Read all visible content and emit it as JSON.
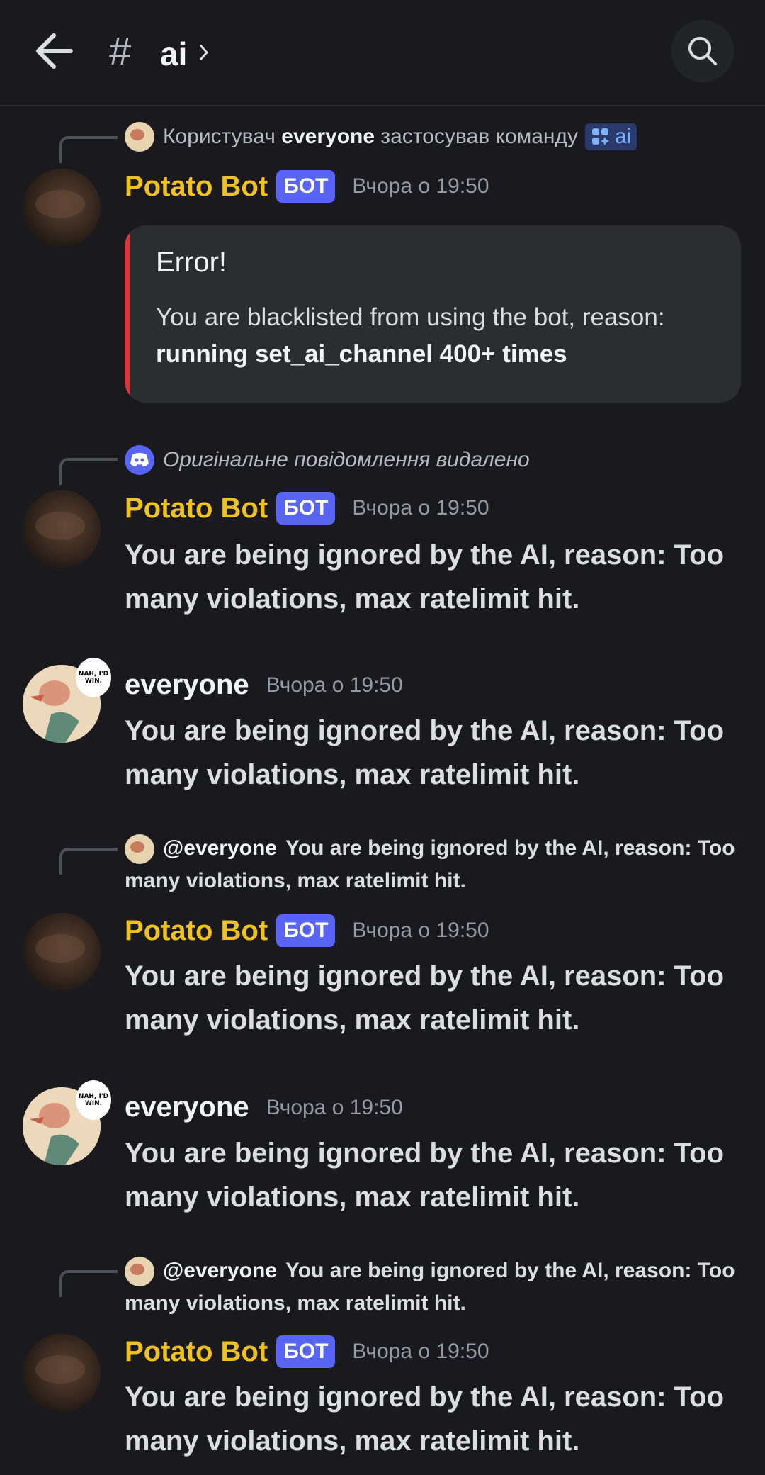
{
  "header": {
    "hash": "#",
    "channel_name": "ai"
  },
  "messages": [
    {
      "type": "command",
      "reply": {
        "prefix": "Користувач",
        "user": "everyone",
        "suffix": "застосував команду",
        "command": "ai"
      },
      "author": "Potato Bot",
      "bot_tag": "БОТ",
      "time": "Вчора о 19:50",
      "embed": {
        "title": "Error!",
        "description": "You are blacklisted from using the bot, reason:",
        "reason": "running set_ai_channel 400+ times",
        "accent": "#da373c"
      }
    },
    {
      "type": "reply_deleted",
      "reply_text": "Оригінальне повідомлення видалено",
      "author": "Potato Bot",
      "bot_tag": "БОТ",
      "time": "Вчора о 19:50",
      "text": "You are being ignored by the AI, reason: Too many violations, max ratelimit hit."
    },
    {
      "type": "user",
      "author": "everyone",
      "time": "Вчора о 19:50",
      "sticker_text": "NAH, I'D WIN.",
      "text": "You are being ignored by the AI, reason: Too many violations, max ratelimit hit."
    },
    {
      "type": "reply",
      "reply_mention": "@everyone",
      "reply_text": "You are being ignored by the AI, reason: Too many violations, max ratelimit hit.",
      "author": "Potato Bot",
      "bot_tag": "БОТ",
      "time": "Вчора о 19:50",
      "text": "You are being ignored by the AI, reason: Too many violations, max ratelimit hit."
    },
    {
      "type": "user",
      "author": "everyone",
      "time": "Вчора о 19:50",
      "sticker_text": "NAH, I'D WIN.",
      "text": "You are being ignored by the AI, reason: Too many violations, max ratelimit hit."
    },
    {
      "type": "reply",
      "reply_mention": "@everyone",
      "reply_text": "You are being ignored by the AI, reason: Too many violations, max ratelimit hit.",
      "author": "Potato Bot",
      "bot_tag": "БОТ",
      "time": "Вчора о 19:50",
      "text": "You are being ignored by the AI, reason: Too many violations, max ratelimit hit."
    }
  ],
  "colors": {
    "bot_name": "#f0c21e",
    "bot_tag": "#5865f2",
    "background": "#1a1a1e"
  }
}
